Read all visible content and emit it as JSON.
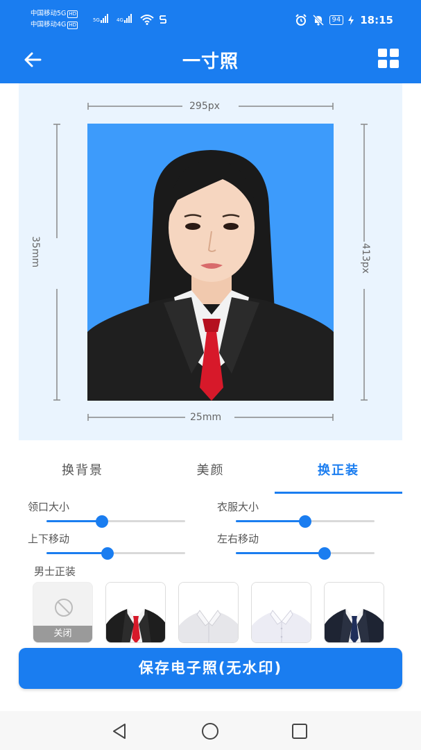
{
  "status_bar": {
    "carrier_1": "中国移动5G",
    "carrier_2": "中国移动4G",
    "hd": "HD",
    "signal_1": "5G",
    "signal_2": "4G",
    "battery": "94",
    "time": "18:15",
    "icons": [
      "alarm-icon",
      "mute-icon",
      "wifi-icon",
      "data-icon",
      "charging-icon"
    ]
  },
  "app_bar": {
    "title": "一寸照",
    "back_icon": "arrow-left-icon",
    "menu_icon": "grid-icon"
  },
  "preview": {
    "width_px": "295px",
    "height_px": "413px",
    "height_mm": "35mm",
    "width_mm": "25mm",
    "background_color": "#3d9bfb"
  },
  "tabs": [
    {
      "label": "换背景",
      "active": false
    },
    {
      "label": "美颜",
      "active": false
    },
    {
      "label": "换正装",
      "active": true
    }
  ],
  "sliders": [
    {
      "label": "领口大小",
      "value": 0.4
    },
    {
      "label": "衣服大小",
      "value": 0.5
    },
    {
      "label": "上下移动",
      "value": 0.44
    },
    {
      "label": "左右移动",
      "value": 0.64
    }
  ],
  "suits": {
    "section_label": "男士正装",
    "off_label": "关闭",
    "items": [
      {
        "name": "black-suit-red-tie",
        "selected": true
      },
      {
        "name": "white-shirt"
      },
      {
        "name": "white-shirt-2"
      },
      {
        "name": "navy-suit-tie"
      }
    ]
  },
  "save_button": "保存电子照(无水印)",
  "colors": {
    "primary": "#1a7df0",
    "preview_bg": "#eaf4fe",
    "photo_bg": "#3d9bfb"
  }
}
